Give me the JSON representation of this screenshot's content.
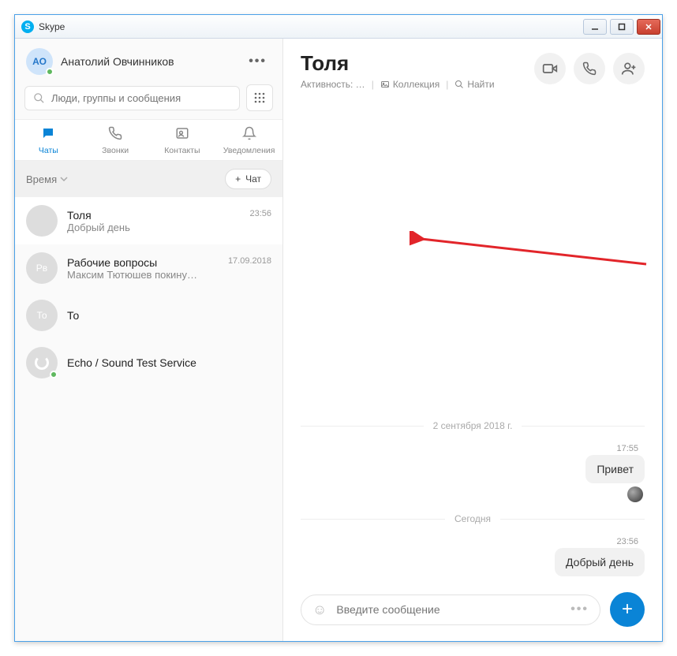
{
  "window": {
    "title": "Skype"
  },
  "profile": {
    "initials": "АО",
    "name": "Анатолий Овчинников"
  },
  "search": {
    "placeholder": "Люди, группы и сообщения"
  },
  "tabs": {
    "chats": "Чаты",
    "calls": "Звонки",
    "contacts": "Контакты",
    "notifications": "Уведомления"
  },
  "filter": {
    "label": "Время",
    "new_chat": "Чат"
  },
  "chats": [
    {
      "name": "Толя",
      "preview": "Добрый день",
      "time": "23:56",
      "avatar": "photo"
    },
    {
      "name": "Рабочие вопросы",
      "preview": "Максим Тютюшев покину…",
      "time": "17.09.2018",
      "avatar": "rv",
      "initials": "Рв"
    },
    {
      "name": "То",
      "preview": "",
      "time": "",
      "avatar": "to",
      "initials": "То"
    },
    {
      "name": "Echo / Sound Test Service",
      "preview": "",
      "time": "",
      "avatar": "echo"
    }
  ],
  "conversation": {
    "title": "Толя",
    "activity": "Активность: …",
    "collection": "Коллекция",
    "find": "Найти",
    "date1": "2 сентября 2018 г.",
    "msg1_time": "17:55",
    "msg1_text": "Привет",
    "date2": "Сегодня",
    "msg2_time": "23:56",
    "msg2_text": "Добрый день",
    "composer_placeholder": "Введите сообщение"
  }
}
